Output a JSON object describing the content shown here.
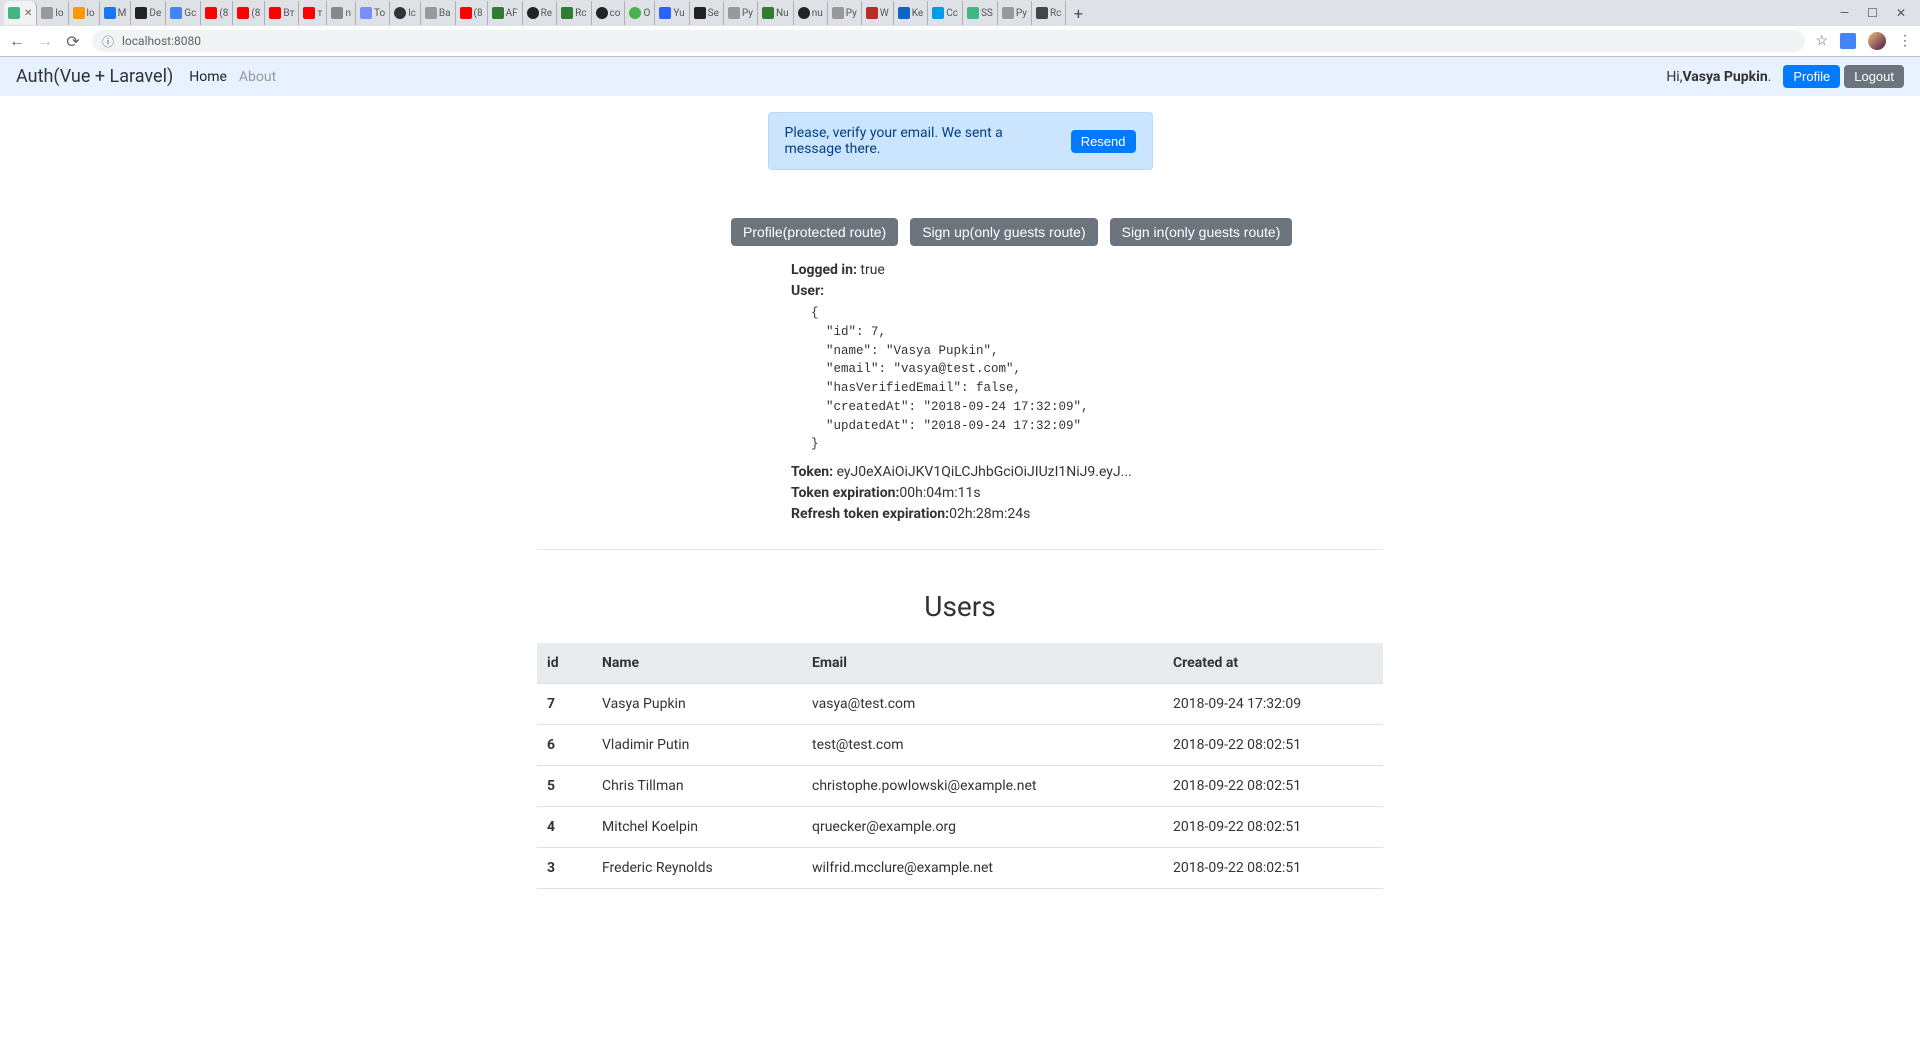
{
  "browser": {
    "url": "localhost:8080",
    "tabs": [
      {
        "label": "",
        "active": true,
        "favicon": "vue"
      },
      {
        "label": "lo",
        "favicon": "doc"
      },
      {
        "label": "lo",
        "favicon": "flame"
      },
      {
        "label": "M",
        "favicon": "fb"
      },
      {
        "label": "De",
        "favicon": "dev"
      },
      {
        "label": "Gc",
        "favicon": "gdoc"
      },
      {
        "label": "(8",
        "favicon": "yt"
      },
      {
        "label": "(8",
        "favicon": "yt"
      },
      {
        "label": "Вт",
        "favicon": "yt"
      },
      {
        "label": "т",
        "favicon": "yt"
      },
      {
        "label": "n",
        "favicon": "wiki"
      },
      {
        "label": "To",
        "favicon": "v"
      },
      {
        "label": "lc",
        "favicon": "circle"
      },
      {
        "label": "Ba",
        "favicon": "doc"
      },
      {
        "label": "(8",
        "favicon": "yt"
      },
      {
        "label": "AF",
        "favicon": "tree"
      },
      {
        "label": "Re",
        "favicon": "gh"
      },
      {
        "label": "Rc",
        "favicon": "tree"
      },
      {
        "label": "co",
        "favicon": "gh"
      },
      {
        "label": "O",
        "favicon": "o"
      },
      {
        "label": "Yu",
        "favicon": "y"
      },
      {
        "label": "Se",
        "favicon": "m"
      },
      {
        "label": "Py",
        "favicon": "doc"
      },
      {
        "label": "Nu",
        "favicon": "tree"
      },
      {
        "label": "nu",
        "favicon": "gh"
      },
      {
        "label": "Py",
        "favicon": "doc"
      },
      {
        "label": "W",
        "favicon": "q"
      },
      {
        "label": "Ke",
        "favicon": "in"
      },
      {
        "label": "Cc",
        "favicon": "gear"
      },
      {
        "label": "SS",
        "favicon": "vue"
      },
      {
        "label": "Py",
        "favicon": "doc"
      },
      {
        "label": "Rc",
        "favicon": "play"
      }
    ]
  },
  "navbar": {
    "brand": "Auth(Vue + Laravel)",
    "home": "Home",
    "about": "About",
    "greeting_prefix": "Hi,",
    "greeting_name": "Vasya Pupkin",
    "greeting_suffix": ".",
    "profile_btn": "Profile",
    "logout_btn": "Logout"
  },
  "alert": {
    "text": "Please, verify your email. We sent a message there.",
    "resend": "Resend"
  },
  "routes": {
    "profile": "Profile(protected route)",
    "signup": "Sign up(only guests route)",
    "signin": "Sign in(only guests route)"
  },
  "status": {
    "logged_in_label": "Logged in:",
    "logged_in_value": "true",
    "user_label": "User:",
    "user_json": "{\n  \"id\": 7,\n  \"name\": \"Vasya Pupkin\",\n  \"email\": \"vasya@test.com\",\n  \"hasVerifiedEmail\": false,\n  \"createdAt\": \"2018-09-24 17:32:09\",\n  \"updatedAt\": \"2018-09-24 17:32:09\"\n}",
    "token_label": "Token:",
    "token_value": "eyJ0eXAiOiJKV1QiLCJhbGciOiJIUzI1NiJ9.eyJ...",
    "token_exp_label": "Token expiration:",
    "token_exp_value": "00h:04m:11s",
    "refresh_exp_label": "Refresh token expiration:",
    "refresh_exp_value": "02h:28m:24s"
  },
  "users": {
    "heading": "Users",
    "columns": {
      "id": "id",
      "name": "Name",
      "email": "Email",
      "created": "Created at"
    },
    "rows": [
      {
        "id": "7",
        "name": "Vasya Pupkin",
        "email": "vasya@test.com",
        "created": "2018-09-24 17:32:09"
      },
      {
        "id": "6",
        "name": "Vladimir Putin",
        "email": "test@test.com",
        "created": "2018-09-22 08:02:51"
      },
      {
        "id": "5",
        "name": "Chris Tillman",
        "email": "christophe.powlowski@example.net",
        "created": "2018-09-22 08:02:51"
      },
      {
        "id": "4",
        "name": "Mitchel Koelpin",
        "email": "qruecker@example.org",
        "created": "2018-09-22 08:02:51"
      },
      {
        "id": "3",
        "name": "Frederic Reynolds",
        "email": "wilfrid.mcclure@example.net",
        "created": "2018-09-22 08:02:51"
      }
    ]
  }
}
